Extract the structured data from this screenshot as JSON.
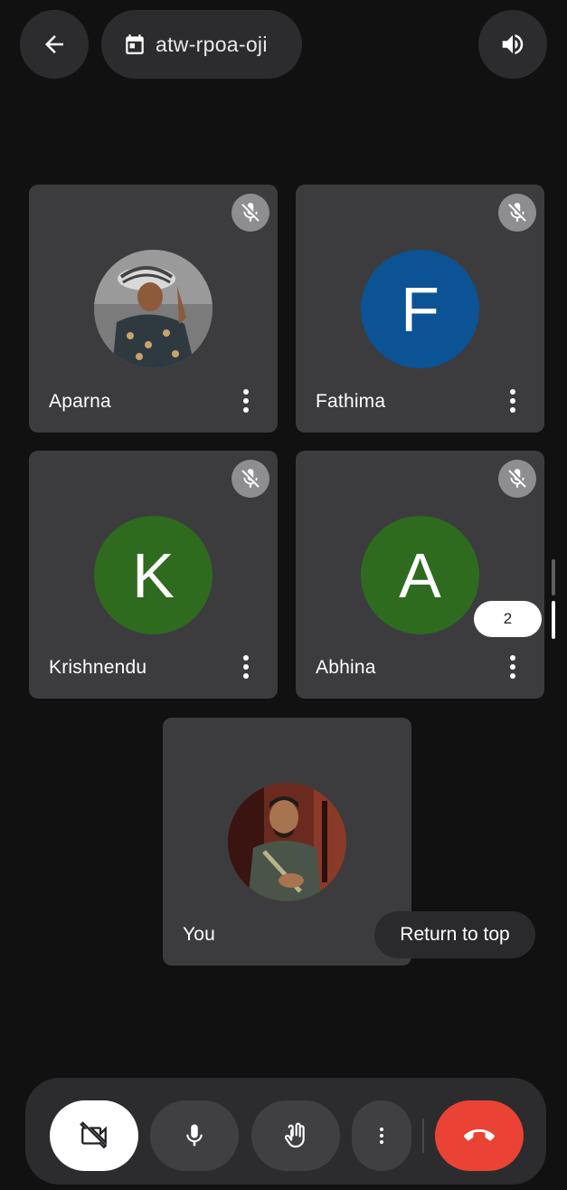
{
  "header": {
    "meeting_code": "atw-rpoa-oji",
    "back_icon": "arrow-left-icon",
    "calendar_icon": "calendar-icon",
    "speaker_icon": "speaker-icon"
  },
  "participants": [
    {
      "name": "Aparna",
      "avatar_type": "photo",
      "muted": true
    },
    {
      "name": "Fathima",
      "avatar_letter": "F",
      "avatar_color": "#0b5394",
      "muted": true
    },
    {
      "name": "Krishnendu",
      "avatar_letter": "K",
      "avatar_color": "#2e6b1f",
      "muted": true
    },
    {
      "name": "Abhina",
      "avatar_letter": "A",
      "avatar_color": "#2e6b1f",
      "muted": true
    }
  ],
  "self_tile": {
    "name": "You",
    "avatar_type": "photo"
  },
  "pager": {
    "page": "2"
  },
  "return_to_top": "Return to top",
  "controls": {
    "camera_icon": "video-off-icon",
    "mic_icon": "mic-icon",
    "hand_icon": "raise-hand-icon",
    "more_icon": "more-vert-icon",
    "end_icon": "call-end-icon"
  },
  "colors": {
    "background": "#111111",
    "tile": "#3c3c3e",
    "end_call": "#ea4335"
  }
}
